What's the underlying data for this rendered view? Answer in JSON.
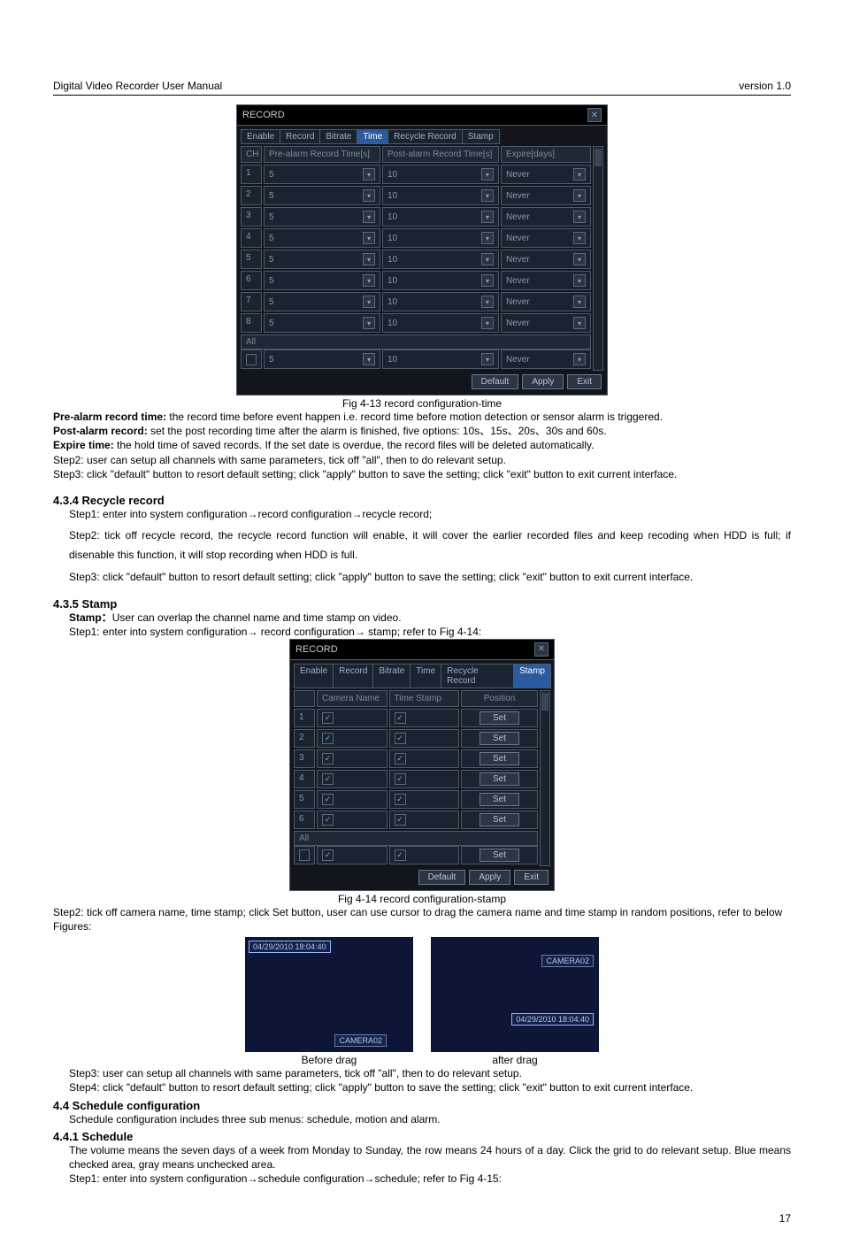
{
  "header": {
    "title": "Digital Video Recorder User Manual",
    "version": "version 1.0"
  },
  "dlg1": {
    "title": "RECORD",
    "tabs": [
      "Enable",
      "Record",
      "Bitrate",
      "Time",
      "Recycle Record",
      "Stamp"
    ],
    "active_tab_index": 3,
    "cols": {
      "ch": "CH",
      "pre": "Pre-alarm Record Time[s]",
      "post": "Post-alarm Record Time[s]",
      "exp": "Expire[days]"
    },
    "rows": [
      {
        "ch": "1",
        "pre": "5",
        "post": "10",
        "exp": "Never"
      },
      {
        "ch": "2",
        "pre": "5",
        "post": "10",
        "exp": "Never"
      },
      {
        "ch": "3",
        "pre": "5",
        "post": "10",
        "exp": "Never"
      },
      {
        "ch": "4",
        "pre": "5",
        "post": "10",
        "exp": "Never"
      },
      {
        "ch": "5",
        "pre": "5",
        "post": "10",
        "exp": "Never"
      },
      {
        "ch": "6",
        "pre": "5",
        "post": "10",
        "exp": "Never"
      },
      {
        "ch": "7",
        "pre": "5",
        "post": "10",
        "exp": "Never"
      },
      {
        "ch": "8",
        "pre": "5",
        "post": "10",
        "exp": "Never"
      }
    ],
    "all_label": "All",
    "all": {
      "pre": "5",
      "post": "10",
      "exp": "Never"
    },
    "btns": {
      "default": "Default",
      "apply": "Apply",
      "exit": "Exit"
    }
  },
  "cap1": "Fig 4-13 record configuration-time",
  "para1": {
    "pre_b": "Pre-alarm record time:",
    "pre_t": " the record time before event happen i.e. record time before motion detection or sensor alarm is triggered.",
    "post_b": "Post-alarm record:",
    "post_t": " set the post recording time after the alarm is finished, five options: 10s、15s、20s、30s and 60s.",
    "exp_b": "Expire time:",
    "exp_t": " the hold time of saved records. If the set date is overdue, the record files will be deleted automatically.",
    "step2": "Step2: user can setup all channels with same parameters, tick off \"all\", then to do relevant setup.",
    "step3": "Step3: click \"default\" button to resort default setting; click \"apply\" button to save the setting; click \"exit\" button to exit current interface."
  },
  "s434": {
    "head": "4.3.4  Recycle record",
    "s1": "Step1: enter into system configuration→record configuration→recycle record;",
    "s2": "Step2: tick off recycle record, the recycle record function will enable, it will cover the earlier recorded files and keep recoding when HDD is full; if disenable this function, it will stop recording when HDD is full.",
    "s3": "Step3: click \"default\" button to resort default setting; click \"apply\" button to save the setting; click \"exit\" button to exit current interface."
  },
  "s435": {
    "head": "4.3.5  Stamp",
    "intro_b": "Stamp：",
    "intro_t": "User can overlap the channel name and time stamp on video.",
    "s1": "Step1: enter into system configuration→ record configuration→ stamp; refer to Fig 4-14:"
  },
  "dlg2": {
    "title": "RECORD",
    "tabs": [
      "Enable",
      "Record",
      "Bitrate",
      "Time",
      "Recycle Record",
      "Stamp"
    ],
    "active_tab_index": 5,
    "cols": {
      "cam": "Camera Name",
      "ts": "Time Stamp",
      "pos": "Position"
    },
    "rows": [
      {
        "ch": "1"
      },
      {
        "ch": "2"
      },
      {
        "ch": "3"
      },
      {
        "ch": "4"
      },
      {
        "ch": "5"
      },
      {
        "ch": "6"
      }
    ],
    "set": "Set",
    "all_label": "All",
    "btns": {
      "default": "Default",
      "apply": "Apply",
      "exit": "Exit"
    }
  },
  "cap2": "Fig 4-14 record configuration-stamp",
  "para2": {
    "s2": "Step2: tick off camera name, time stamp; click Set button, user can use cursor to drag the camera name and time stamp in random positions, refer to below Figures:"
  },
  "drag": {
    "ts": "04/29/2010 18:04:40",
    "cam": "CAMERA02",
    "before": "Before drag",
    "after": "after drag"
  },
  "para3": {
    "s3": "Step3: user can setup all channels with same parameters, tick off \"all\", then to do relevant setup.",
    "s4": "Step4: click \"default\" button to resort default setting; click \"apply\" button to save the setting; click \"exit\" button to exit current interface."
  },
  "s44": {
    "head": "4.4  Schedule configuration",
    "t": "Schedule configuration includes three sub menus: schedule, motion and alarm."
  },
  "s441": {
    "head": "4.4.1  Schedule",
    "t1": "The volume means the seven days of a week from Monday to Sunday, the row means 24 hours of a day. Click the grid to do relevant setup. Blue means checked area, gray means unchecked area.",
    "t2": "Step1: enter into system configuration→schedule configuration→schedule; refer to Fig 4-15:"
  },
  "pagenum": "17"
}
